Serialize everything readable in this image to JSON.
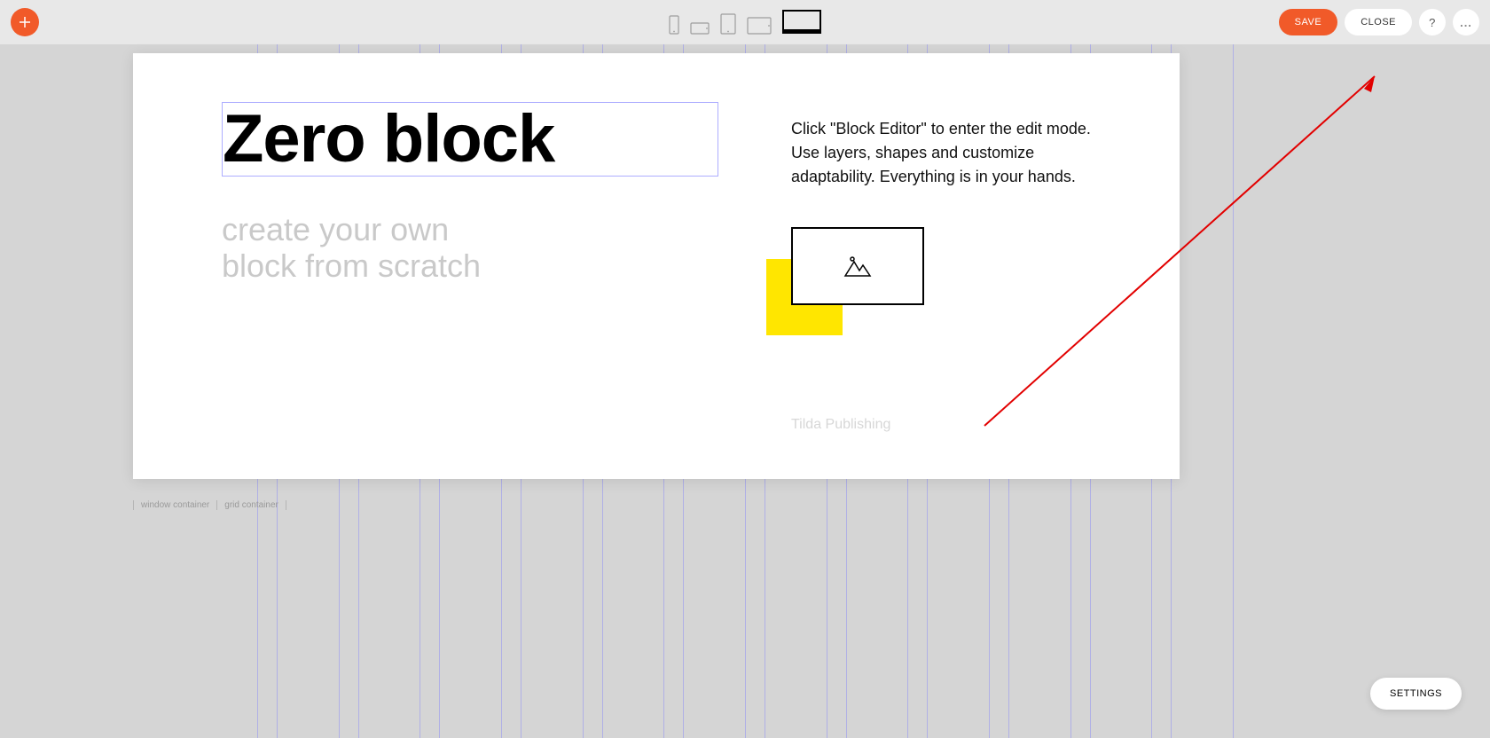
{
  "toolbar": {
    "save_label": "SAVE",
    "close_label": "CLOSE",
    "help_label": "?",
    "more_label": "..."
  },
  "devices": {
    "icons": [
      "phone-portrait",
      "phone-landscape",
      "tablet-portrait",
      "tablet-landscape",
      "desktop"
    ],
    "active_index": 4
  },
  "block": {
    "heading": "Zero block",
    "subheading_line1": "create your own",
    "subheading_line2": "block from scratch",
    "description": "Click \"Block Editor\" to enter the edit mode. Use layers, shapes and customize adaptability. Everything is in your hands.",
    "credit": "Tilda Publishing"
  },
  "labels": {
    "window_container": "window container",
    "grid_container": "grid container"
  },
  "footer": {
    "settings_label": "SETTINGS"
  },
  "colors": {
    "accent": "#f15a29",
    "highlight": "#ffe600",
    "guide": "rgba(120,120,255,0.4)"
  }
}
